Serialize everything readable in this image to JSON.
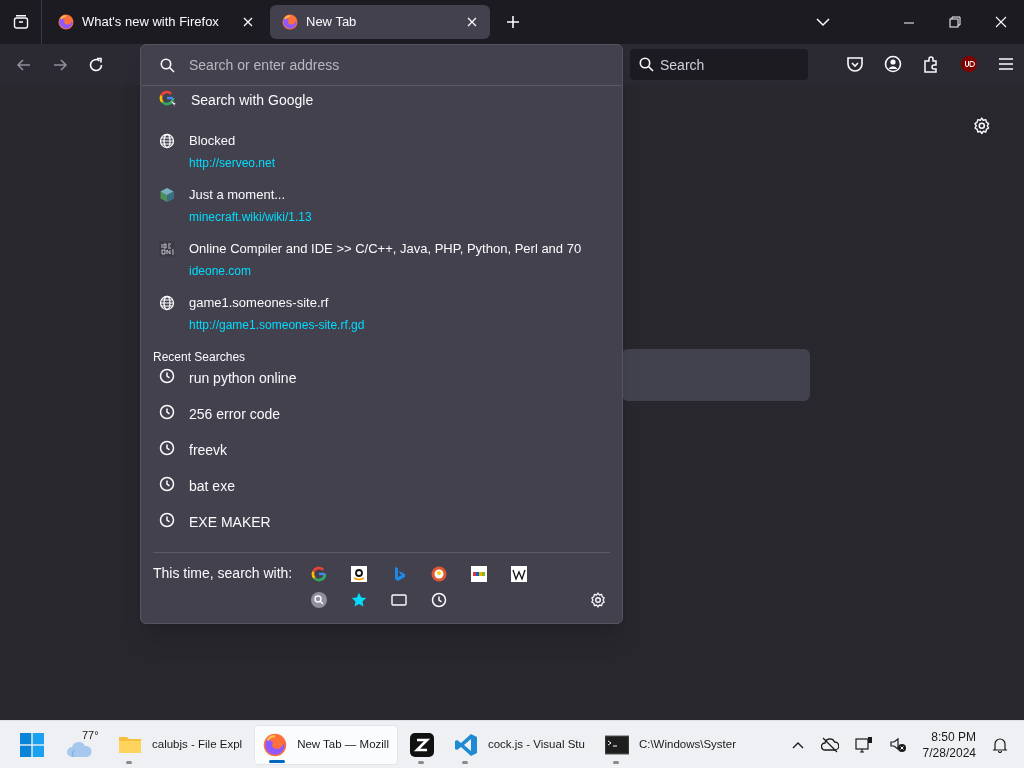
{
  "tabs": [
    {
      "title": "What's new with Firefox",
      "selected": false
    },
    {
      "title": "New Tab",
      "selected": true
    }
  ],
  "toolbar": {
    "search_placeholder": "Search"
  },
  "address_bar": {
    "placeholder": "Search or enter address"
  },
  "dropdown": {
    "search_suggestion": "Search with Google",
    "results": [
      {
        "kind": "globe",
        "title": "Blocked",
        "url": "http://serveo.net"
      },
      {
        "kind": "cube",
        "title": "Just a moment...",
        "url": "minecraft.wiki/wiki/1.13"
      },
      {
        "kind": "ide",
        "title": "Online Compiler and IDE >> C/C++, Java, PHP, Python, Perl and 70",
        "url": "ideone.com"
      },
      {
        "kind": "globe",
        "title": "game1.someones-site.rf",
        "url": "http://game1.someones-site.rf.gd"
      }
    ],
    "recent_heading": "Recent Searches",
    "recent": [
      "run python online",
      "256 error code",
      "freevk",
      "bat exe",
      "EXE MAKER"
    ],
    "engines_label": "This time, search with:"
  },
  "taskbar": {
    "weather": "77°",
    "apps": [
      {
        "kind": "folder",
        "label": "calubjs - File Expl",
        "selected": false
      },
      {
        "kind": "firefox",
        "label": "New Tab — Mozill",
        "selected": true
      },
      {
        "kind": "z",
        "selected": false
      },
      {
        "kind": "vscode",
        "label": "cock.js - Visual Stu",
        "selected": false
      },
      {
        "kind": "terminal",
        "label": "C:\\Windows\\Syster",
        "selected": false
      }
    ],
    "time": "8:50 PM",
    "date": "7/28/2024"
  }
}
